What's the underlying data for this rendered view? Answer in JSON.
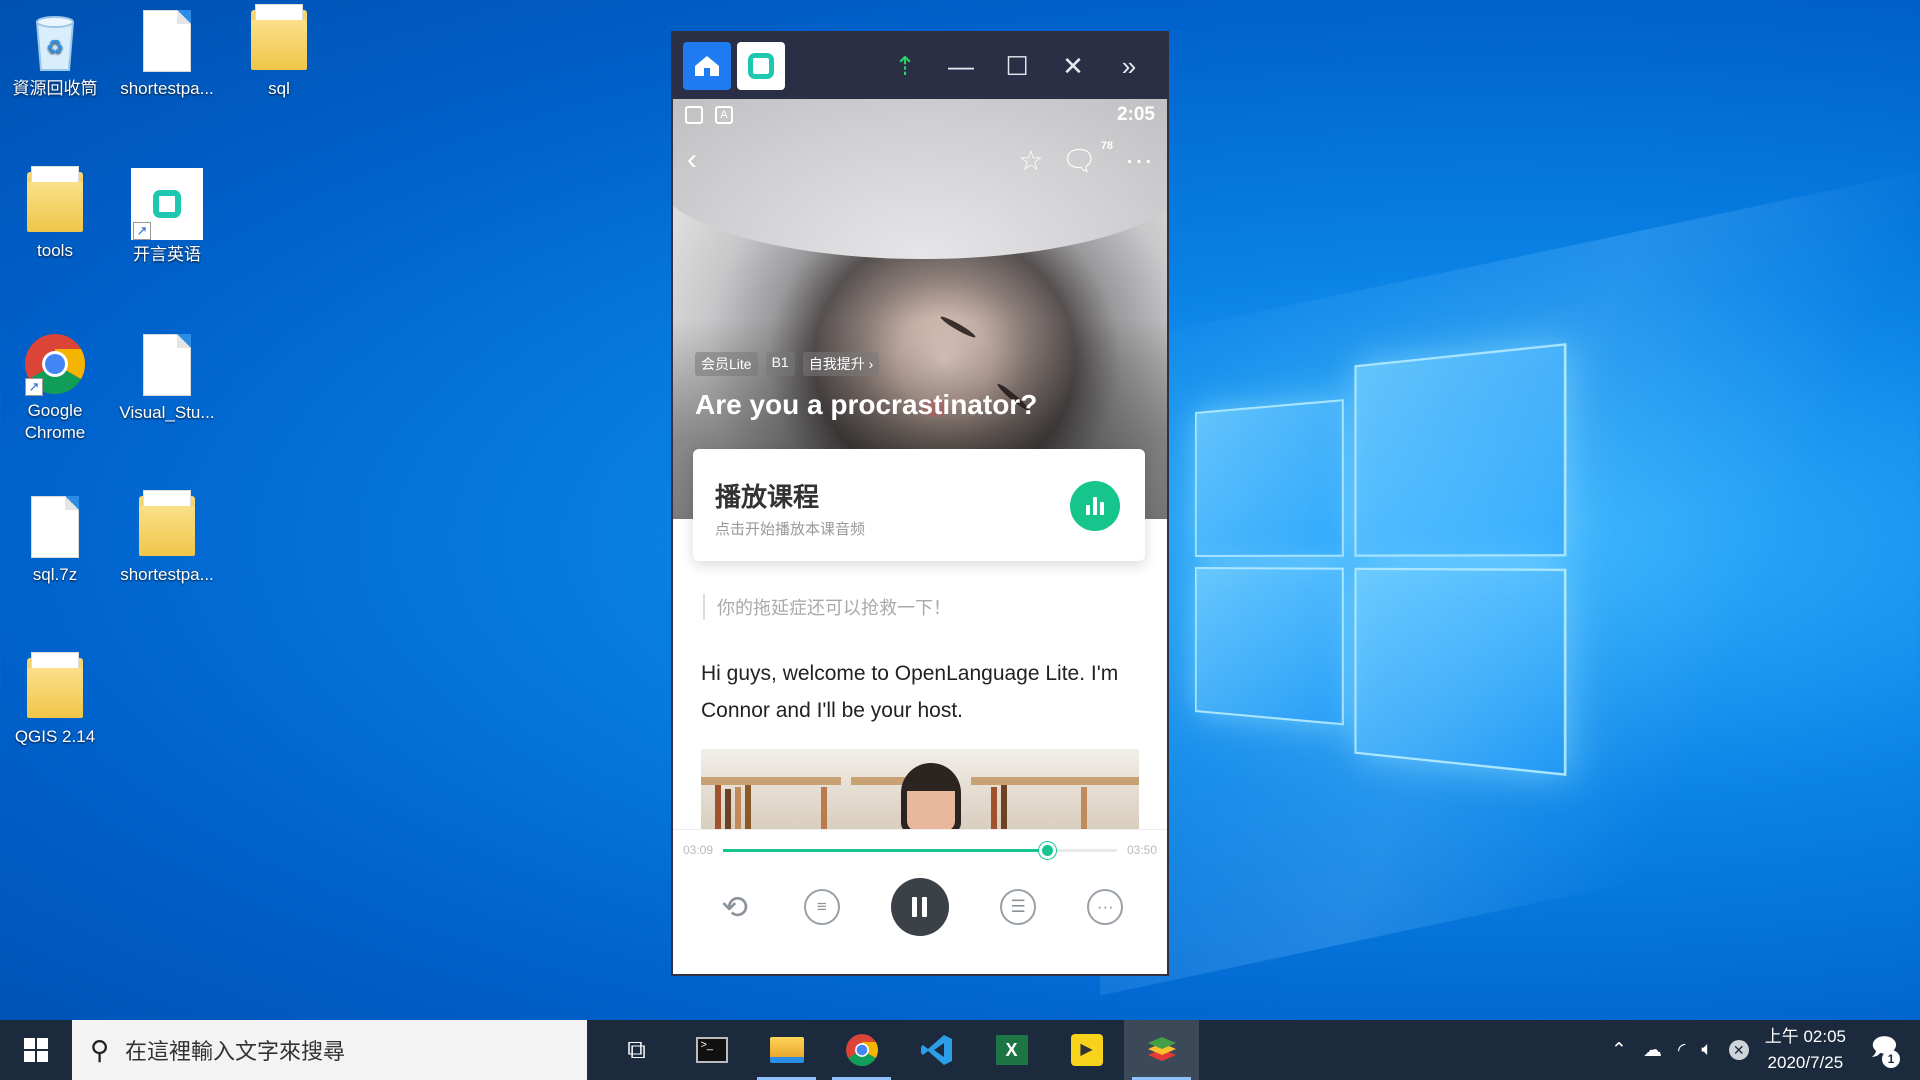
{
  "desktop": {
    "icons": [
      {
        "label": "資源回收筒",
        "icon": "recycle-bin-icon"
      },
      {
        "label": "shortestpa...",
        "icon": "file-icon"
      },
      {
        "label": "sql",
        "icon": "folder-icon"
      },
      {
        "label": "tools",
        "icon": "folder-icon"
      },
      {
        "label": "开言英语",
        "icon": "app-shortcut-icon"
      },
      {
        "label": "Google Chrome",
        "icon": "chrome-icon"
      },
      {
        "label": "Visual_Stu...",
        "icon": "file-icon"
      },
      {
        "label": "sql.7z",
        "icon": "file-icon"
      },
      {
        "label": "shortestpa...",
        "icon": "zip-folder-icon"
      },
      {
        "label": "QGIS 2.14",
        "icon": "folder-icon"
      }
    ]
  },
  "emulator": {
    "status": {
      "time": "2:05"
    },
    "nav": {
      "comment_count": "78"
    },
    "lesson": {
      "tags": [
        "会员Lite",
        "B1",
        "自我提升 ›"
      ],
      "title": "Are you a procrastinator?",
      "play_title": "播放课程",
      "play_sub": "点击开始播放本课音频",
      "quote": "你的拖延症还可以抢救一下！",
      "body": "Hi guys, welcome to OpenLanguage Lite. I'm Connor and I'll be your host."
    },
    "player": {
      "elapsed": "03:09",
      "total": "03:50",
      "progress": 0.822
    }
  },
  "taskbar": {
    "search_placeholder": "在這裡輸入文字來搜尋",
    "time": "上午 02:05",
    "date": "2020/7/25",
    "notification_count": "1"
  },
  "colors": {
    "accent": "#16c58c",
    "taskbar": "#1b2a3c",
    "emulator_bar": "#2b2f45"
  }
}
